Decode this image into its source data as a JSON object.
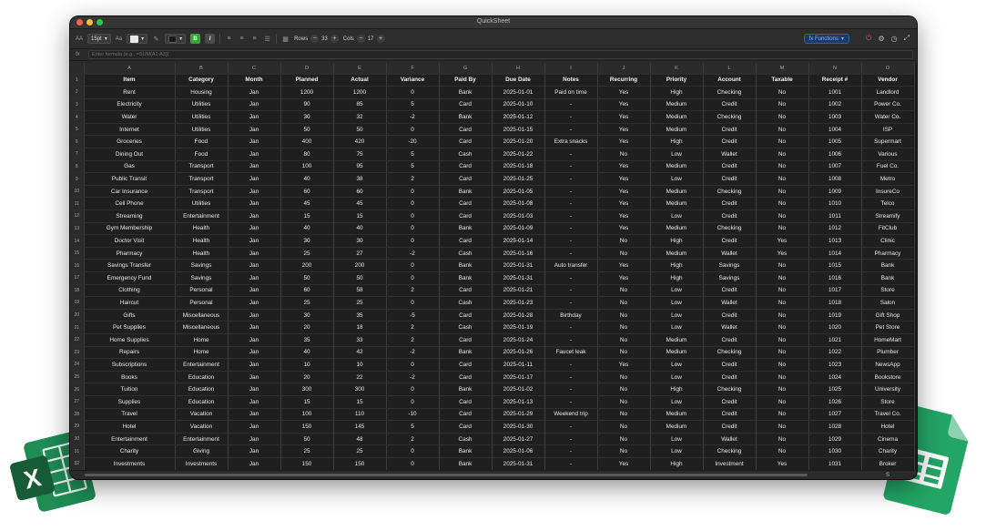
{
  "window": {
    "title": "QuickSheet"
  },
  "toolbar": {
    "font_size_icon": "AA",
    "font_size": "15pt",
    "case_icon": "Aa",
    "bold": "B",
    "italic": "I",
    "rows_label": "Rows",
    "rows_value": "33",
    "cols_label": "Cols",
    "cols_value": "17",
    "functions_label": "fx Functions",
    "accent": "#2f5ea8"
  },
  "formula_bar": {
    "fx_label": "fx",
    "placeholder": "Enter formula (e.g., =SUM(A1:A3))"
  },
  "grid": {
    "columns": [
      "A",
      "B",
      "C",
      "D",
      "E",
      "F",
      "G",
      "H",
      "I",
      "J",
      "K",
      "L",
      "M",
      "N",
      "O"
    ],
    "header": [
      "Item",
      "Category",
      "Month",
      "Planned",
      "Actual",
      "Variance",
      "Paid By",
      "Due Date",
      "Notes",
      "Recurring",
      "Priority",
      "Account",
      "Taxable",
      "Receipt #",
      "Vendor"
    ],
    "rows": [
      [
        "Rent",
        "Housing",
        "Jan",
        "1200",
        "1200",
        "0",
        "Bank",
        "2025-01-01",
        "Paid on time",
        "Yes",
        "High",
        "Checking",
        "No",
        "1001",
        "Landlord"
      ],
      [
        "Electricity",
        "Utilities",
        "Jan",
        "90",
        "85",
        "5",
        "Card",
        "2025-01-10",
        "-",
        "Yes",
        "Medium",
        "Credit",
        "No",
        "1002",
        "Power Co."
      ],
      [
        "Water",
        "Utilities",
        "Jan",
        "30",
        "32",
        "-2",
        "Bank",
        "2025-01-12",
        "-",
        "Yes",
        "Medium",
        "Checking",
        "No",
        "1003",
        "Water Co."
      ],
      [
        "Internet",
        "Utilities",
        "Jan",
        "50",
        "50",
        "0",
        "Card",
        "2025-01-15",
        "-",
        "Yes",
        "Medium",
        "Credit",
        "No",
        "1004",
        "ISP"
      ],
      [
        "Groceries",
        "Food",
        "Jan",
        "400",
        "420",
        "-20",
        "Card",
        "2025-01-20",
        "Extra snacks",
        "Yes",
        "High",
        "Credit",
        "No",
        "1005",
        "Supermart"
      ],
      [
        "Dining Out",
        "Food",
        "Jan",
        "80",
        "75",
        "5",
        "Cash",
        "2025-01-22",
        "-",
        "No",
        "Low",
        "Wallet",
        "No",
        "1006",
        "Various"
      ],
      [
        "Gas",
        "Transport",
        "Jan",
        "100",
        "95",
        "5",
        "Card",
        "2025-01-18",
        "-",
        "Yes",
        "Medium",
        "Credit",
        "No",
        "1007",
        "Fuel Co."
      ],
      [
        "Public Transit",
        "Transport",
        "Jan",
        "40",
        "38",
        "2",
        "Card",
        "2025-01-25",
        "-",
        "Yes",
        "Low",
        "Credit",
        "No",
        "1008",
        "Metro"
      ],
      [
        "Car Insurance",
        "Transport",
        "Jan",
        "60",
        "60",
        "0",
        "Bank",
        "2025-01-05",
        "-",
        "Yes",
        "Medium",
        "Checking",
        "No",
        "1009",
        "InsureCo"
      ],
      [
        "Cell Phone",
        "Utilities",
        "Jan",
        "45",
        "45",
        "0",
        "Card",
        "2025-01-08",
        "-",
        "Yes",
        "Medium",
        "Credit",
        "No",
        "1010",
        "Telco"
      ],
      [
        "Streaming",
        "Entertainment",
        "Jan",
        "15",
        "15",
        "0",
        "Card",
        "2025-01-03",
        "-",
        "Yes",
        "Low",
        "Credit",
        "No",
        "1011",
        "Streamify"
      ],
      [
        "Gym Membership",
        "Health",
        "Jan",
        "40",
        "40",
        "0",
        "Bank",
        "2025-01-09",
        "-",
        "Yes",
        "Medium",
        "Checking",
        "No",
        "1012",
        "FitClub"
      ],
      [
        "Doctor Visit",
        "Health",
        "Jan",
        "30",
        "30",
        "0",
        "Card",
        "2025-01-14",
        "-",
        "No",
        "High",
        "Credit",
        "Yes",
        "1013",
        "Clinic"
      ],
      [
        "Pharmacy",
        "Health",
        "Jan",
        "25",
        "27",
        "-2",
        "Cash",
        "2025-01-16",
        "-",
        "No",
        "Medium",
        "Wallet",
        "Yes",
        "1014",
        "Pharmacy"
      ],
      [
        "Savings Transfer",
        "Savings",
        "Jan",
        "200",
        "200",
        "0",
        "Bank",
        "2025-01-31",
        "Auto transfer",
        "Yes",
        "High",
        "Savings",
        "No",
        "1015",
        "Bank"
      ],
      [
        "Emergency Fund",
        "Savings",
        "Jan",
        "50",
        "50",
        "0",
        "Bank",
        "2025-01-31",
        "-",
        "Yes",
        "High",
        "Savings",
        "No",
        "1016",
        "Bank"
      ],
      [
        "Clothing",
        "Personal",
        "Jan",
        "60",
        "58",
        "2",
        "Card",
        "2025-01-21",
        "-",
        "No",
        "Low",
        "Credit",
        "No",
        "1017",
        "Store"
      ],
      [
        "Haircut",
        "Personal",
        "Jan",
        "25",
        "25",
        "0",
        "Cash",
        "2025-01-23",
        "-",
        "No",
        "Low",
        "Wallet",
        "No",
        "1018",
        "Salon"
      ],
      [
        "Gifts",
        "Miscellaneous",
        "Jan",
        "30",
        "35",
        "-5",
        "Card",
        "2025-01-28",
        "Birthday",
        "No",
        "Low",
        "Credit",
        "No",
        "1019",
        "Gift Shop"
      ],
      [
        "Pet Supplies",
        "Miscellaneous",
        "Jan",
        "20",
        "18",
        "2",
        "Cash",
        "2025-01-19",
        "-",
        "No",
        "Low",
        "Wallet",
        "No",
        "1020",
        "Pet Store"
      ],
      [
        "Home Supplies",
        "Home",
        "Jan",
        "35",
        "33",
        "2",
        "Card",
        "2025-01-24",
        "-",
        "No",
        "Medium",
        "Credit",
        "No",
        "1021",
        "HomeMart"
      ],
      [
        "Repairs",
        "Home",
        "Jan",
        "40",
        "42",
        "-2",
        "Bank",
        "2025-01-26",
        "Faucet leak",
        "No",
        "Medium",
        "Checking",
        "No",
        "1022",
        "Plumber"
      ],
      [
        "Subscriptions",
        "Entertainment",
        "Jan",
        "10",
        "10",
        "0",
        "Card",
        "2025-01-11",
        "-",
        "Yes",
        "Low",
        "Credit",
        "No",
        "1023",
        "NewsApp"
      ],
      [
        "Books",
        "Education",
        "Jan",
        "20",
        "22",
        "-2",
        "Card",
        "2025-01-17",
        "-",
        "No",
        "Low",
        "Credit",
        "No",
        "1024",
        "Bookstore"
      ],
      [
        "Tuition",
        "Education",
        "Jan",
        "300",
        "300",
        "0",
        "Bank",
        "2025-01-02",
        "-",
        "No",
        "High",
        "Checking",
        "No",
        "1025",
        "University"
      ],
      [
        "Supplies",
        "Education",
        "Jan",
        "15",
        "15",
        "0",
        "Card",
        "2025-01-13",
        "-",
        "No",
        "Low",
        "Credit",
        "No",
        "1026",
        "Store"
      ],
      [
        "Travel",
        "Vacation",
        "Jan",
        "100",
        "110",
        "-10",
        "Card",
        "2025-01-29",
        "Weekend trip",
        "No",
        "Medium",
        "Credit",
        "No",
        "1027",
        "Travel Co."
      ],
      [
        "Hotel",
        "Vacation",
        "Jan",
        "150",
        "145",
        "5",
        "Card",
        "2025-01-30",
        "-",
        "No",
        "Medium",
        "Credit",
        "No",
        "1028",
        "Hotel"
      ],
      [
        "Entertainment",
        "Entertainment",
        "Jan",
        "50",
        "48",
        "2",
        "Cash",
        "2025-01-27",
        "-",
        "No",
        "Low",
        "Wallet",
        "No",
        "1029",
        "Cinema"
      ],
      [
        "Charity",
        "Giving",
        "Jan",
        "25",
        "25",
        "0",
        "Bank",
        "2025-01-06",
        "-",
        "No",
        "Low",
        "Checking",
        "No",
        "1030",
        "Charity"
      ],
      [
        "Investments",
        "Investments",
        "Jan",
        "150",
        "150",
        "0",
        "Bank",
        "2025-01-31",
        "-",
        "Yes",
        "High",
        "Investment",
        "Yes",
        "1031",
        "Broker"
      ]
    ]
  },
  "status": {
    "corner_text": "S"
  }
}
